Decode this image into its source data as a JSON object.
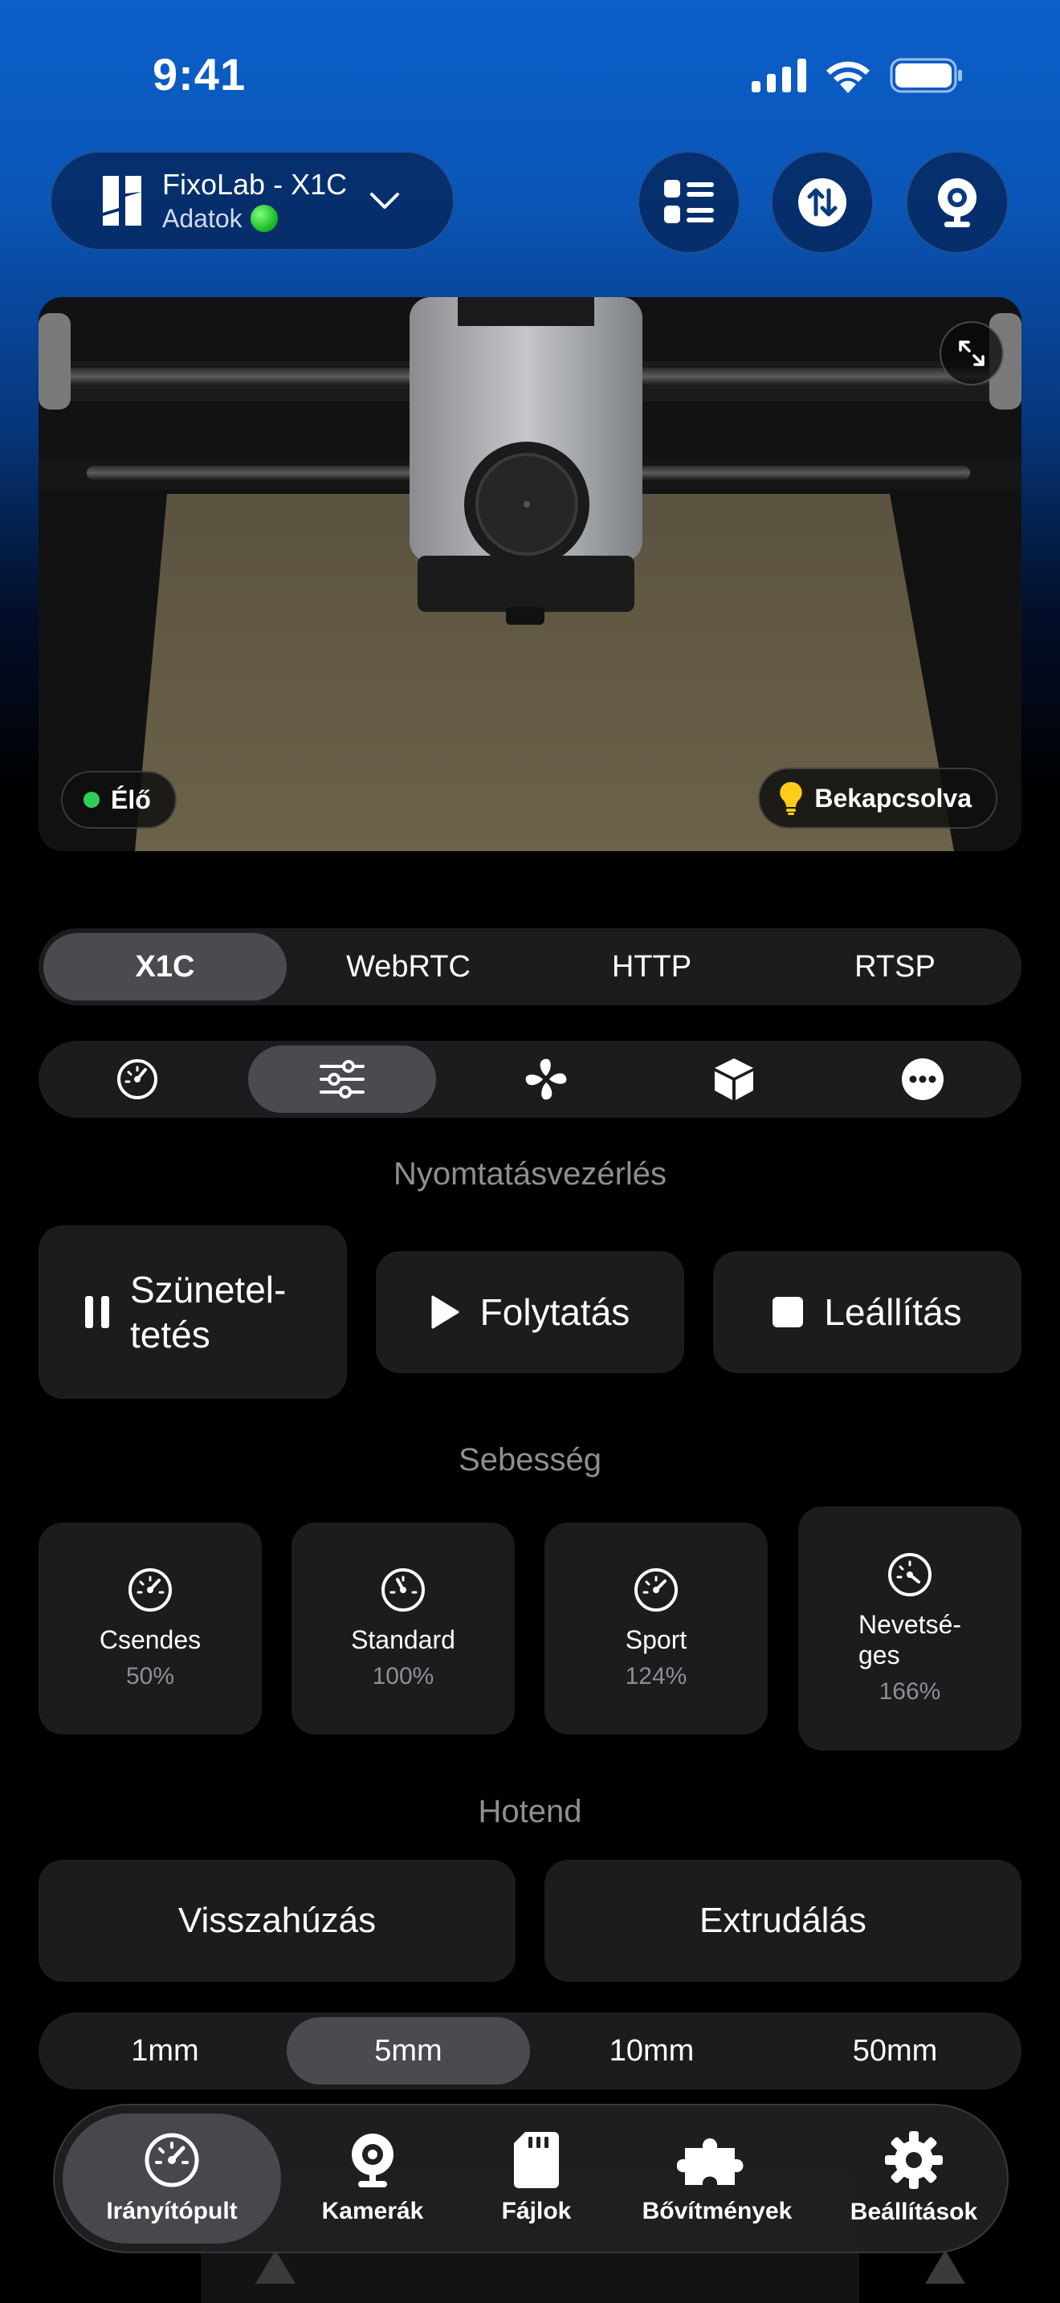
{
  "status_bar": {
    "time": "9:41"
  },
  "header": {
    "printer_name": "FixoLab - X1C",
    "printer_subtitle": "Adatok",
    "buttons": [
      "list-icon",
      "transfer-icon",
      "webcam-icon"
    ]
  },
  "camera": {
    "live_label": "Élő",
    "light_label": "Bekapcsolva"
  },
  "stream_tabs": {
    "items": [
      "X1C",
      "WebRTC",
      "HTTP",
      "RTSP"
    ],
    "selected": "X1C"
  },
  "category_tabs": {
    "icons": [
      "speedometer-icon",
      "sliders-icon",
      "fan-icon",
      "box-icon",
      "more-icon"
    ],
    "selected_index": 1
  },
  "print_control": {
    "title": "Nyomtatásvezérlés",
    "pause_line1": "Szünetel-",
    "pause_line2": "tetés",
    "resume": "Folytatás",
    "stop": "Leállítás"
  },
  "speed": {
    "title": "Sebesség",
    "modes": [
      {
        "label": "Csendes",
        "value": "50%"
      },
      {
        "label": "Standard",
        "value": "100%"
      },
      {
        "label": "Sport",
        "value": "124%"
      },
      {
        "label_line1": "Nevetsé-",
        "label_line2": "ges",
        "value": "166%"
      }
    ]
  },
  "hotend": {
    "title": "Hotend",
    "retract": "Visszahúzás",
    "extrude": "Extrudálás",
    "distances": [
      "1mm",
      "5mm",
      "10mm",
      "50mm"
    ],
    "selected_distance": "5mm"
  },
  "tab_bar": {
    "items": [
      "Irányítópult",
      "Kamerák",
      "Fájlok",
      "Bővítmények",
      "Beállítások"
    ],
    "selected": "Irányítópult"
  }
}
